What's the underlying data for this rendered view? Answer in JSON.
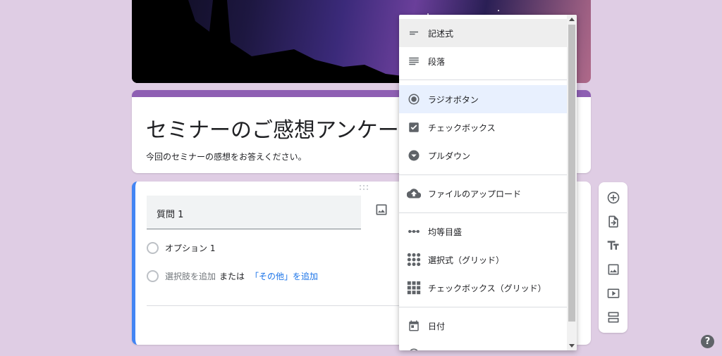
{
  "form": {
    "title": "セミナーのご感想アンケート",
    "description": "今回のセミナーの感想をお答えください。"
  },
  "question": {
    "title": "質問 1",
    "option1": "オプション 1",
    "add_option": "選択肢を追加",
    "or": "または",
    "add_other": "「その他」を追加"
  },
  "menu": {
    "items": [
      {
        "label": "記述式",
        "icon": "short-answer-icon"
      },
      {
        "label": "段落",
        "icon": "paragraph-icon"
      },
      {
        "label": "ラジオボタン",
        "icon": "radio-button-icon"
      },
      {
        "label": "チェックボックス",
        "icon": "checkbox-icon"
      },
      {
        "label": "プルダウン",
        "icon": "dropdown-icon"
      },
      {
        "label": "ファイルのアップロード",
        "icon": "cloud-upload-icon"
      },
      {
        "label": "均等目盛",
        "icon": "linear-scale-icon"
      },
      {
        "label": "選択式（グリッド）",
        "icon": "multiple-choice-grid-icon"
      },
      {
        "label": "チェックボックス（グリッド）",
        "icon": "checkbox-grid-icon"
      },
      {
        "label": "日付",
        "icon": "calendar-icon"
      }
    ],
    "hovered": "記述式",
    "selected": "ラジオボタン"
  },
  "toolbar": {
    "icons": [
      "add-question-icon",
      "import-questions-icon",
      "add-title-icon",
      "add-image-icon",
      "add-video-icon",
      "add-section-icon"
    ]
  },
  "help": {
    "label": "?"
  },
  "colors": {
    "background": "#dfcde4",
    "theme": "#8e5fb3",
    "accent": "#4285f4",
    "link": "#1a73e8"
  }
}
